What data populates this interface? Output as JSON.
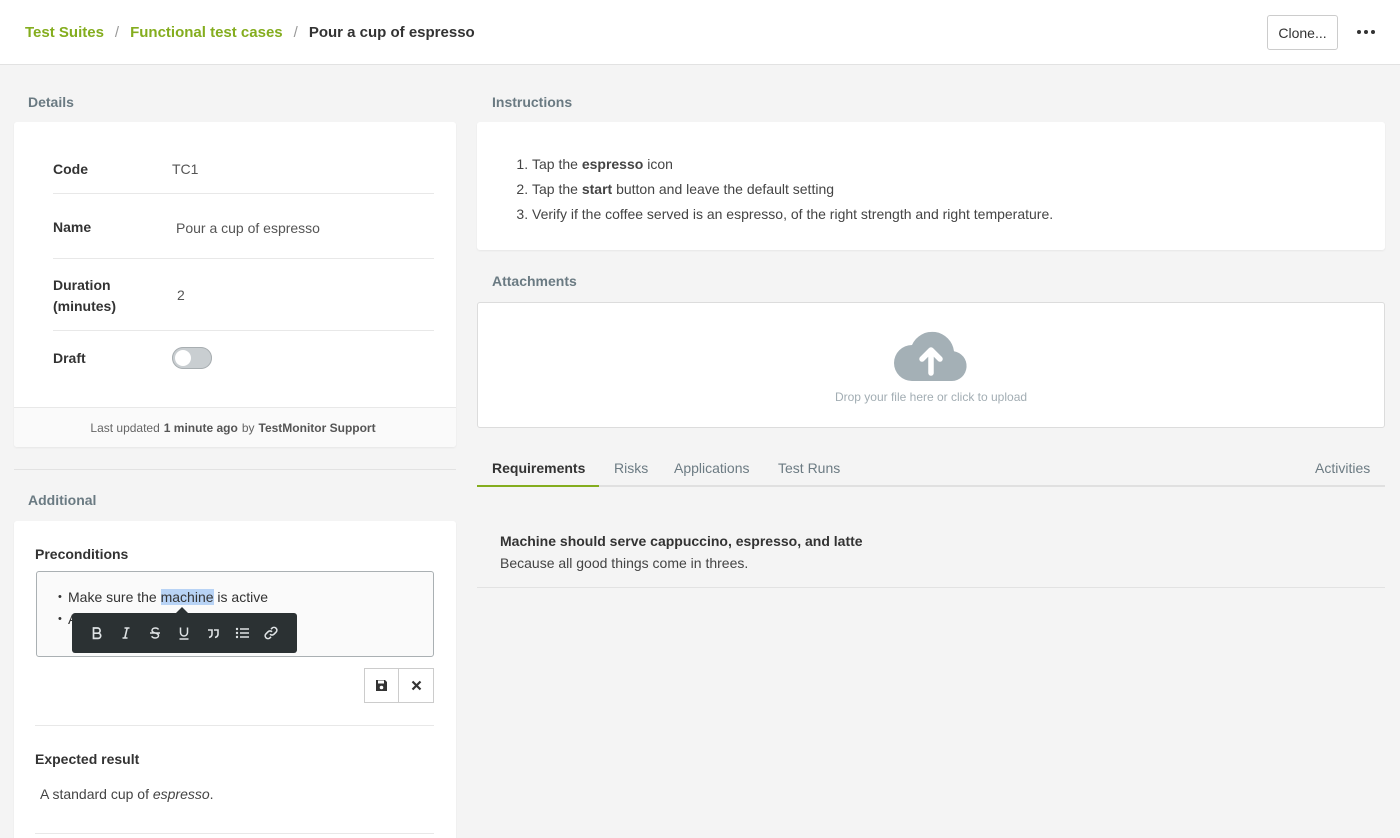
{
  "breadcrumb": {
    "items": [
      "Test Suites",
      "Functional test cases"
    ],
    "separator": "/",
    "current": "Pour a cup of espresso"
  },
  "header": {
    "clone_label": "Clone..."
  },
  "details": {
    "section_title": "Details",
    "rows": [
      {
        "label": "Code",
        "value": "TC1"
      },
      {
        "label": "Name",
        "value": "Pour a cup of espresso"
      },
      {
        "label": "Duration (minutes)",
        "value": "2"
      },
      {
        "label": "Draft",
        "value": false
      }
    ],
    "footer": {
      "prefix": "Last updated",
      "time": "1 minute ago",
      "by": "by",
      "user": "TestMonitor Support"
    }
  },
  "additional": {
    "section_title": "Additional",
    "preconditions_label": "Preconditions",
    "preconditions": {
      "line1_pre": "Make sure the",
      "line1_highlight": "machine",
      "line1_post": "is active",
      "line2": "A cup should be present"
    },
    "expected_label": "Expected result",
    "expected": {
      "pre": "A standard cup of",
      "em": "espresso",
      "post": "."
    }
  },
  "instructions": {
    "section_title": "Instructions",
    "steps": [
      {
        "pre": "Tap the",
        "bold": "espresso",
        "post": "icon"
      },
      {
        "pre": "Tap the",
        "bold": "start",
        "post": "button and leave the default setting"
      },
      {
        "text": "Verify if the coffee served is an espresso, of the right strength and right temperature."
      }
    ]
  },
  "attachments": {
    "section_title": "Attachments",
    "drop_text": "Drop your file here or click to upload",
    "icon": "cloud-upload-icon"
  },
  "tabs": {
    "items": [
      "Requirements",
      "Risks",
      "Applications",
      "Test Runs"
    ],
    "right": "Activities",
    "active": "Requirements"
  },
  "requirements": [
    {
      "title": "Machine should serve cappuccino, espresso, and latte",
      "description": "Because all good things come in threes."
    }
  ],
  "colors": {
    "accent": "#84ad1e",
    "highlight": "#b8d3f5",
    "toolbar": "#2b3133"
  }
}
